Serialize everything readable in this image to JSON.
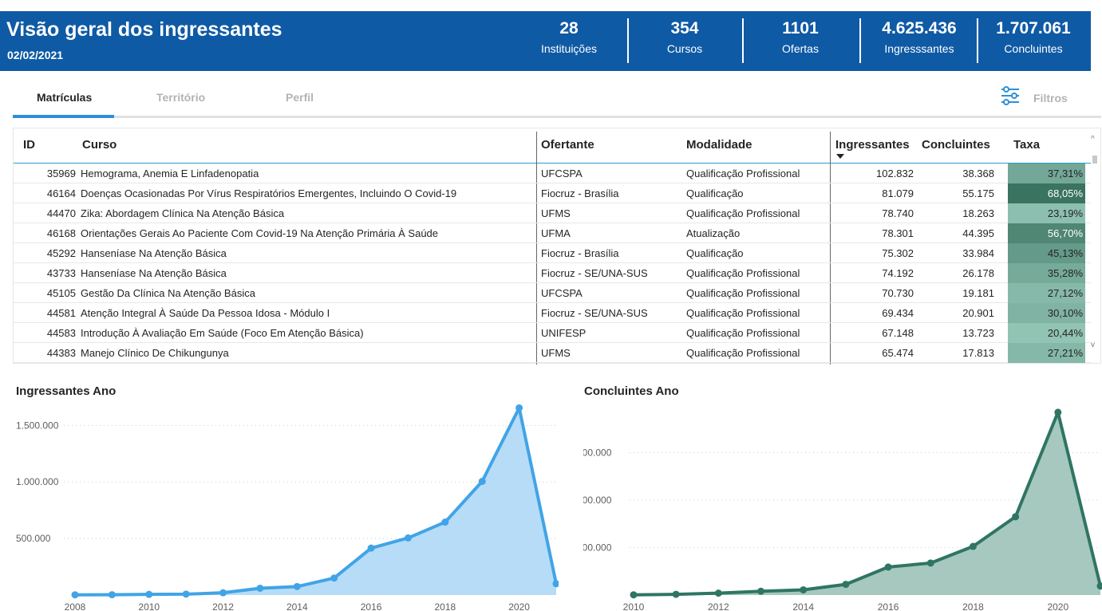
{
  "header": {
    "title": "Visão geral dos ingressantes",
    "date": "02/02/2021",
    "kpis": [
      {
        "value": "28",
        "label": "Instituições"
      },
      {
        "value": "354",
        "label": "Cursos"
      },
      {
        "value": "1101",
        "label": "Ofertas"
      },
      {
        "value": "4.625.436",
        "label": "Ingresssantes"
      },
      {
        "value": "1.707.061",
        "label": "Concluintes"
      }
    ]
  },
  "tabs": [
    {
      "label": "Matrículas",
      "active": true
    },
    {
      "label": "Território",
      "active": false
    },
    {
      "label": "Perfil",
      "active": false
    }
  ],
  "filters_label": "Filtros",
  "table": {
    "columns": [
      "ID",
      "Curso",
      "Ofertante",
      "Modalidade",
      "Ingressantes",
      "Concluintes",
      "Taxa"
    ],
    "rows": [
      {
        "id": "35969",
        "curso": "Hemograma, Anemia E Linfadenopatia",
        "ofertante": "UFCSPA",
        "modalidade": "Qualificação Profissional",
        "ingressantes": "102.832",
        "concluintes": "38.368",
        "taxa": "37,31%"
      },
      {
        "id": "46164",
        "curso": "Doenças Ocasionadas Por Vírus Respiratórios Emergentes, Incluindo O Covid-19",
        "ofertante": "Fiocruz - Brasília",
        "modalidade": "Qualificação",
        "ingressantes": "81.079",
        "concluintes": "55.175",
        "taxa": "68,05%"
      },
      {
        "id": "44470",
        "curso": "Zika: Abordagem Clínica Na Atenção Básica",
        "ofertante": "UFMS",
        "modalidade": "Qualificação Profissional",
        "ingressantes": "78.740",
        "concluintes": "18.263",
        "taxa": "23,19%"
      },
      {
        "id": "46168",
        "curso": "Orientações Gerais Ao Paciente Com Covid-19 Na Atenção Primária À Saúde",
        "ofertante": "UFMA",
        "modalidade": "Atualização",
        "ingressantes": "78.301",
        "concluintes": "44.395",
        "taxa": "56,70%"
      },
      {
        "id": "45292",
        "curso": "Hanseníase Na Atenção Básica",
        "ofertante": "Fiocruz - Brasília",
        "modalidade": "Qualificação",
        "ingressantes": "75.302",
        "concluintes": "33.984",
        "taxa": "45,13%"
      },
      {
        "id": "43733",
        "curso": "Hanseníase Na Atenção Básica",
        "ofertante": "Fiocruz - SE/UNA-SUS",
        "modalidade": "Qualificação Profissional",
        "ingressantes": "74.192",
        "concluintes": "26.178",
        "taxa": "35,28%"
      },
      {
        "id": "45105",
        "curso": "Gestão Da Clínica Na Atenção Básica",
        "ofertante": "UFCSPA",
        "modalidade": "Qualificação Profissional",
        "ingressantes": "70.730",
        "concluintes": "19.181",
        "taxa": "27,12%"
      },
      {
        "id": "44581",
        "curso": "Atenção Integral À Saúde Da Pessoa Idosa - Módulo I",
        "ofertante": "Fiocruz - SE/UNA-SUS",
        "modalidade": "Qualificação Profissional",
        "ingressantes": "69.434",
        "concluintes": "20.901",
        "taxa": "30,10%"
      },
      {
        "id": "44583",
        "curso": "Introdução À Avaliação Em Saúde (Foco Em Atenção Básica)",
        "ofertante": "UNIFESP",
        "modalidade": "Qualificação Profissional",
        "ingressantes": "67.148",
        "concluintes": "13.723",
        "taxa": "20,44%"
      },
      {
        "id": "44383",
        "curso": "Manejo Clínico De Chikungunya",
        "ofertante": "UFMS",
        "modalidade": "Qualificação Profissional",
        "ingressantes": "65.474",
        "concluintes": "17.813",
        "taxa": "27,21%"
      }
    ]
  },
  "colors": {
    "header_bg": "#0F5AA5",
    "ingressantes_line": "#41A4E6",
    "ingressantes_fill": "#B7DCF7",
    "concluintes_line": "#2F7564",
    "concluintes_fill": "#A6C8BE",
    "tab_active_underline": "#2F8FD6"
  },
  "chart_data": [
    {
      "type": "area",
      "title": "Ingressantes Ano",
      "x": [
        2008,
        2009,
        2010,
        2011,
        2012,
        2013,
        2014,
        2015,
        2016,
        2017,
        2018,
        2019,
        2020,
        2021
      ],
      "values": [
        2000,
        3000,
        6000,
        8000,
        20000,
        60000,
        75000,
        150000,
        415000,
        505000,
        645000,
        1005000,
        1655000,
        100000
      ],
      "x_ticks": [
        "2008",
        "2010",
        "2012",
        "2014",
        "2016",
        "2018",
        "2020"
      ],
      "y_ticks": [
        "500.000",
        "1.000.000",
        "1.500.000"
      ],
      "ylim": [
        0,
        1700000
      ],
      "xlim": [
        2008,
        2021
      ]
    },
    {
      "type": "area",
      "title": "Concluintes Ano",
      "x": [
        2010,
        2011,
        2012,
        2013,
        2014,
        2015,
        2016,
        2017,
        2018,
        2019,
        2020,
        2021
      ],
      "values": [
        1000,
        3000,
        8000,
        16000,
        22000,
        45000,
        118000,
        135000,
        205000,
        330000,
        770000,
        38000
      ],
      "x_ticks": [
        "2010",
        "2012",
        "2014",
        "2016",
        "2018",
        "2020"
      ],
      "y_ticks": [
        "200.000",
        "400.000",
        "600.000"
      ],
      "ylim": [
        0,
        800000
      ],
      "xlim": [
        2010,
        2021
      ]
    }
  ]
}
